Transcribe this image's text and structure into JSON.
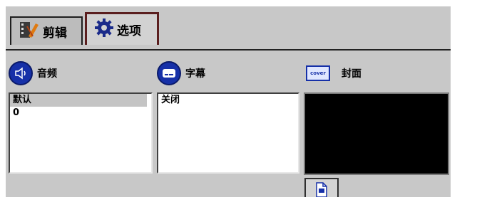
{
  "tabs": {
    "edit_label": "剪辑",
    "options_label": "选项"
  },
  "audio": {
    "title": "音频",
    "items": [
      "默认",
      "0"
    ]
  },
  "subtitle": {
    "title": "字幕",
    "items": [
      "关闭"
    ]
  },
  "cover": {
    "title": "封面",
    "icon_text": "cover"
  },
  "colors": {
    "panel": "#c8c8c8",
    "accent_blue": "#1630a8",
    "selected_tab_border": "#5a1e1e"
  },
  "icons": [
    "film-edit-icon",
    "gear-icon",
    "speaker-icon",
    "subtitle-icon",
    "cover-icon",
    "file-icon"
  ]
}
